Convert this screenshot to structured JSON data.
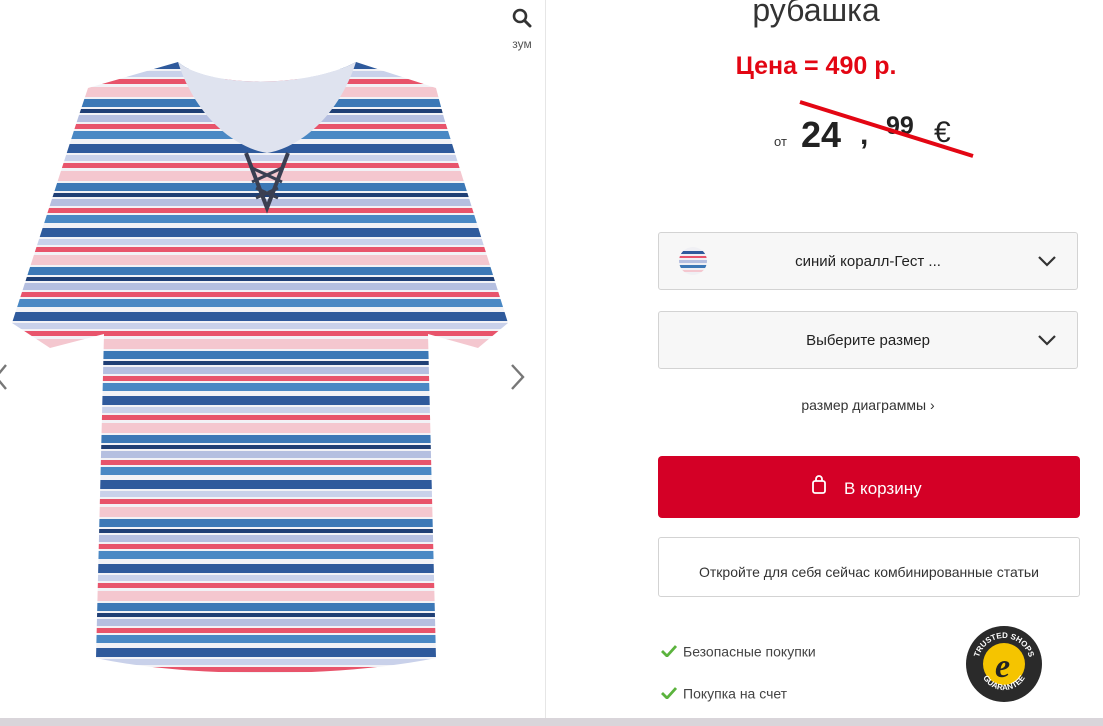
{
  "gallery": {
    "zoom_label": "зум",
    "icons": {
      "zoom": "search-icon",
      "prev": "chevron-left-icon",
      "next": "chevron-right-icon"
    }
  },
  "product": {
    "title": "рубашка",
    "price_note": "Цена = 490 р.",
    "price": {
      "prefix": "от",
      "integer": "24",
      "separator": ",",
      "cents": "99",
      "currency": "€",
      "struck_through": true
    }
  },
  "options": {
    "color": {
      "label": "синий коралл-Гест ...",
      "icon": "chevron-down-icon"
    },
    "size": {
      "label": "Выберите размер",
      "icon": "chevron-down-icon"
    },
    "size_chart_label": "размер диаграммы ›"
  },
  "actions": {
    "cart_label": "В корзину",
    "cart_icon": "shopping-bag-icon",
    "combo_label": "Откройте для себя сейчас комбинированные статьи"
  },
  "features": [
    {
      "label": "Безопасные покупки",
      "icon": "check-icon"
    },
    {
      "label": "Покупка на счет",
      "icon": "check-icon"
    }
  ],
  "trust_badge": {
    "lines": [
      "TRUSTED SHOPS",
      "GUARANTEE"
    ],
    "letter": "e"
  },
  "colors": {
    "accent": "#d40026",
    "price_note": "#e30613",
    "check": "#5bb33d"
  }
}
